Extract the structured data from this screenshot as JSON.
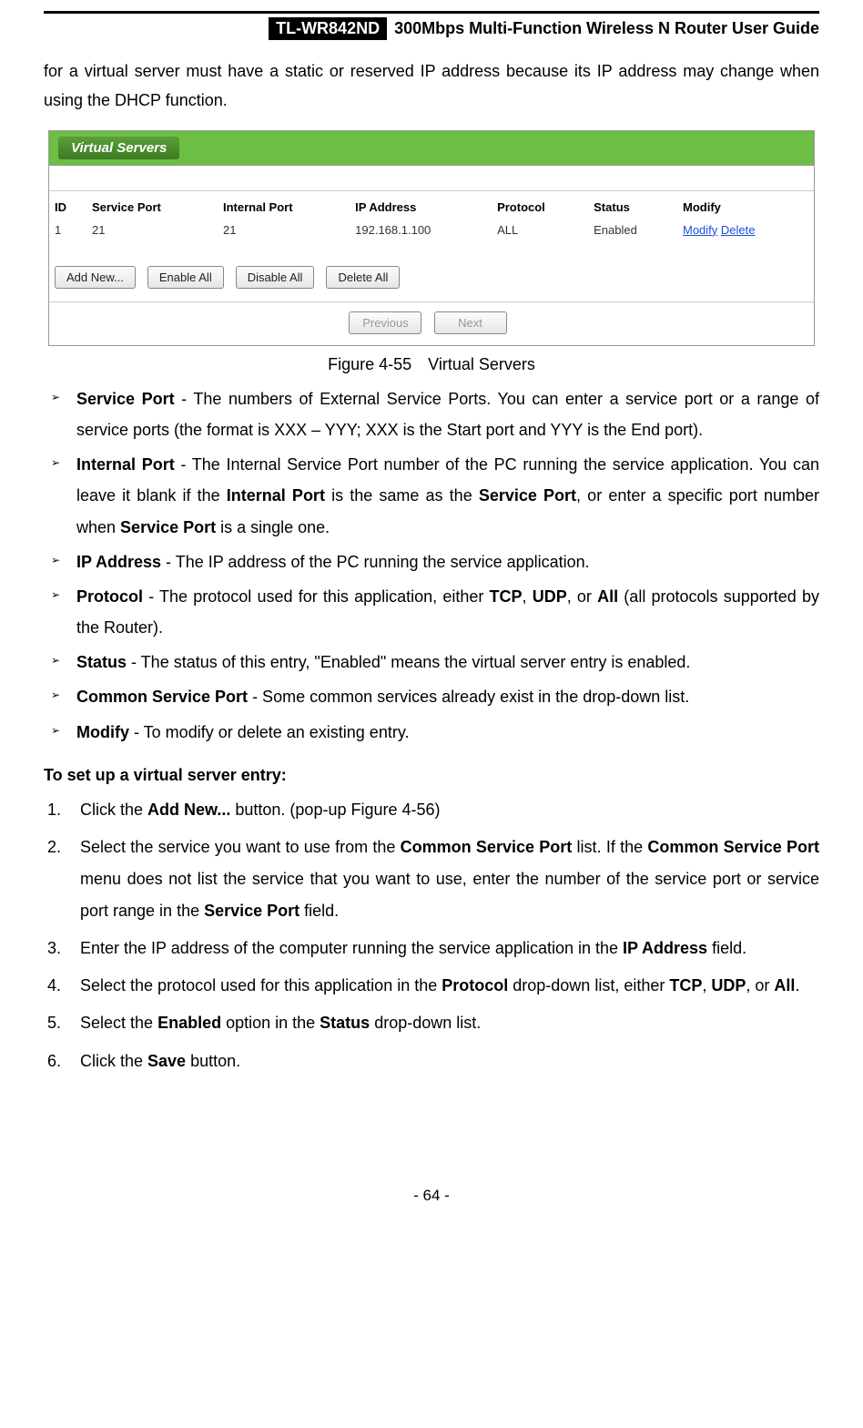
{
  "header": {
    "model": "TL-WR842ND",
    "title": "300Mbps Multi-Function Wireless N Router User Guide"
  },
  "intro": "for a virtual server must have a static or reserved IP address because its IP address may change when using the DHCP function.",
  "figure": {
    "panel_title": "Virtual Servers",
    "columns": [
      "ID",
      "Service Port",
      "Internal Port",
      "IP Address",
      "Protocol",
      "Status",
      "Modify"
    ],
    "row": {
      "id": "1",
      "service_port": "21",
      "internal_port": "21",
      "ip": "192.168.1.100",
      "protocol": "ALL",
      "status": "Enabled",
      "modify": "Modify",
      "delete": "Delete"
    },
    "buttons": {
      "add": "Add New...",
      "enable": "Enable All",
      "disable": "Disable All",
      "delete": "Delete All",
      "prev": "Previous",
      "next": "Next"
    },
    "caption": "Figure 4-55 Virtual Servers"
  },
  "defs": [
    {
      "term": "Service Port",
      "text": " - The numbers of External Service Ports. You can enter a service port or a range of service ports (the format is XXX – YYY; XXX is the Start port and YYY is the End port)."
    },
    {
      "term": "Internal Port",
      "text_pre": " - The Internal Service Port number of the PC running the service application. You can leave it blank if the ",
      "b1": "Internal Port",
      "mid1": " is the same as the ",
      "b2": "Service Port",
      "mid2": ", or enter a specific port number when ",
      "b3": "Service Port",
      "text_post": " is a single one."
    },
    {
      "term": "IP Address",
      "text": " - The IP address of the PC running the service application."
    },
    {
      "term": "Protocol",
      "text_pre": " - The protocol used for this application, either ",
      "b1": "TCP",
      "mid1": ", ",
      "b2": "UDP",
      "mid2": ", or ",
      "b3": "All",
      "text_post": " (all protocols supported by the Router)."
    },
    {
      "term": "Status",
      "text": " - The status of this entry, \"Enabled\" means the virtual server entry is enabled."
    },
    {
      "term": "Common Service Port",
      "text": " - Some common services already exist in the drop-down list."
    },
    {
      "term": "Modify",
      "text": " - To modify or delete an existing entry."
    }
  ],
  "setup_title": "To set up a virtual server entry:",
  "steps": {
    "s1_pre": "Click the ",
    "s1_b": "Add New...",
    "s1_post": " button. (pop-up Figure 4-56)",
    "s2_pre": "Select the service you want to use from the ",
    "s2_b1": "Common Service Port",
    "s2_mid1": " list. If the ",
    "s2_b2": "Common Service Port",
    "s2_mid2": " menu does not list the service that you want to use, enter the number of the service port or service port range in the ",
    "s2_b3": "Service Port",
    "s2_post": " field.",
    "s3_pre": "Enter the IP address of the computer running the service application in the ",
    "s3_b": "IP Address",
    "s3_post": " field.",
    "s4_pre": "Select the protocol used for this application in the ",
    "s4_b1": "Protocol",
    "s4_mid1": " drop-down list, either ",
    "s4_b2": "TCP",
    "s4_mid2": ", ",
    "s4_b3": "UDP",
    "s4_mid3": ", or ",
    "s4_b4": "All",
    "s4_post": ".",
    "s5_pre": "Select the ",
    "s5_b1": "Enabled",
    "s5_mid": " option in the ",
    "s5_b2": "Status",
    "s5_post": " drop-down list.",
    "s6_pre": "Click the ",
    "s6_b": "Save",
    "s6_post": " button."
  },
  "footer": "- 64 -"
}
